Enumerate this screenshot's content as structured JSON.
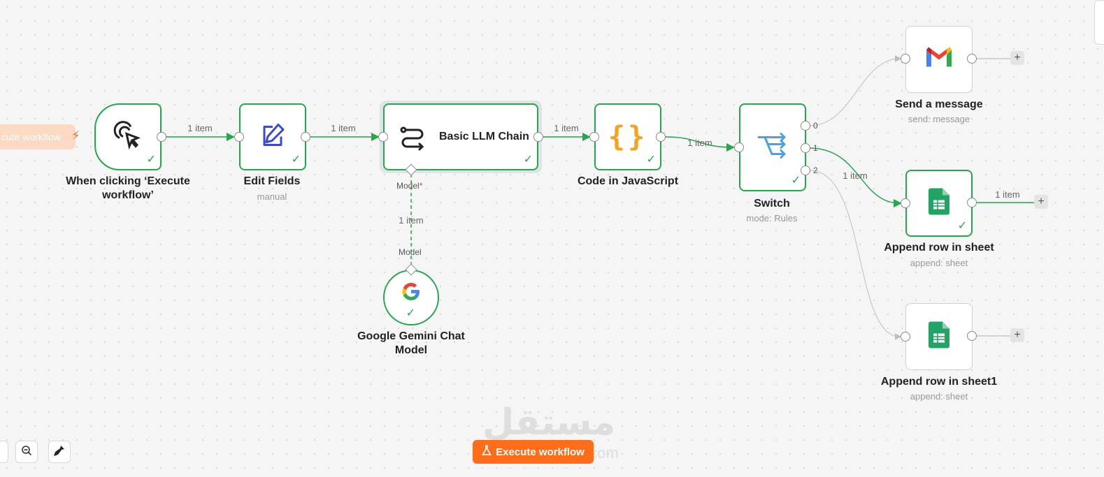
{
  "trigger_tab": {
    "label": "cute workflow"
  },
  "nodes": {
    "manual_trigger": {
      "title": "When clicking ‘Execute workflow’"
    },
    "edit_fields": {
      "title": "Edit Fields",
      "subtitle": "manual"
    },
    "llm_chain": {
      "title": "Basic LLM Chain",
      "model_port_label": "Model",
      "model_port_required": "*"
    },
    "code_js": {
      "title": "Code in JavaScript"
    },
    "switch": {
      "title": "Switch",
      "subtitle": "mode: Rules",
      "outputs": [
        "0",
        "1",
        "2"
      ]
    },
    "gemini": {
      "title": "Google Gemini Chat Model",
      "port_label": "Model"
    },
    "send_message": {
      "title": "Send a message",
      "subtitle": "send: message"
    },
    "append_row": {
      "title": "Append row in sheet",
      "subtitle": "append: sheet"
    },
    "append_row1": {
      "title": "Append row in sheet1",
      "subtitle": "append: sheet"
    }
  },
  "edge_labels": {
    "trigger_to_edit": "1 item",
    "edit_to_chain": "1 item",
    "chain_to_code": "1 item",
    "code_to_switch": "1 item",
    "gemini_to_chain": "1 item",
    "switch_to_append": "1 item",
    "append_output": "1 item"
  },
  "add_button_symbol": "+",
  "toolbar": {
    "execute_label": "Execute workflow"
  },
  "watermark": {
    "text": "مستقل",
    "sub": "mostaql.com"
  },
  "colors": {
    "success": "#22a94a",
    "accent": "#ff6d1a",
    "edge": "#22a94a",
    "idle_edge": "#c8c8c8"
  },
  "icons": [
    "pointer-click-icon",
    "edit-pencil-icon",
    "llm-chain-icon",
    "code-braces-icon",
    "switch-icon",
    "gmail-icon",
    "google-sheets-icon",
    "google-icon",
    "zoom-out-icon",
    "clean-up-icon",
    "flask-icon",
    "bolt-icon"
  ]
}
